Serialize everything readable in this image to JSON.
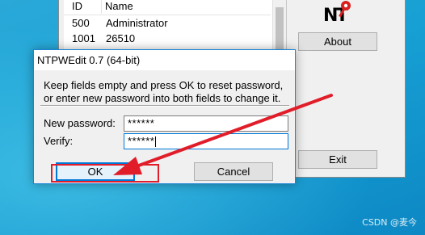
{
  "main_window": {
    "list": {
      "columns": [
        "ID",
        "Name"
      ],
      "rows": [
        {
          "id": "500",
          "name": "Administrator"
        },
        {
          "id": "1001",
          "name": "26510"
        }
      ]
    },
    "about_label": "About",
    "exit_label": "Exit",
    "logo_text": "NT"
  },
  "dialog": {
    "title": "NTPWEdit 0.7 (64-bit)",
    "instructions_line1": "Keep fields empty and press OK to reset password,",
    "instructions_line2": "or enter new password into both fields to change it.",
    "new_password_label": "New password:",
    "new_password_value": "******",
    "verify_label": "Verify:",
    "verify_value": "******",
    "ok_label": "OK",
    "cancel_label": "Cancel"
  },
  "annotation": {
    "color": "#e11d2a"
  },
  "watermark": "CSDN @麦今"
}
